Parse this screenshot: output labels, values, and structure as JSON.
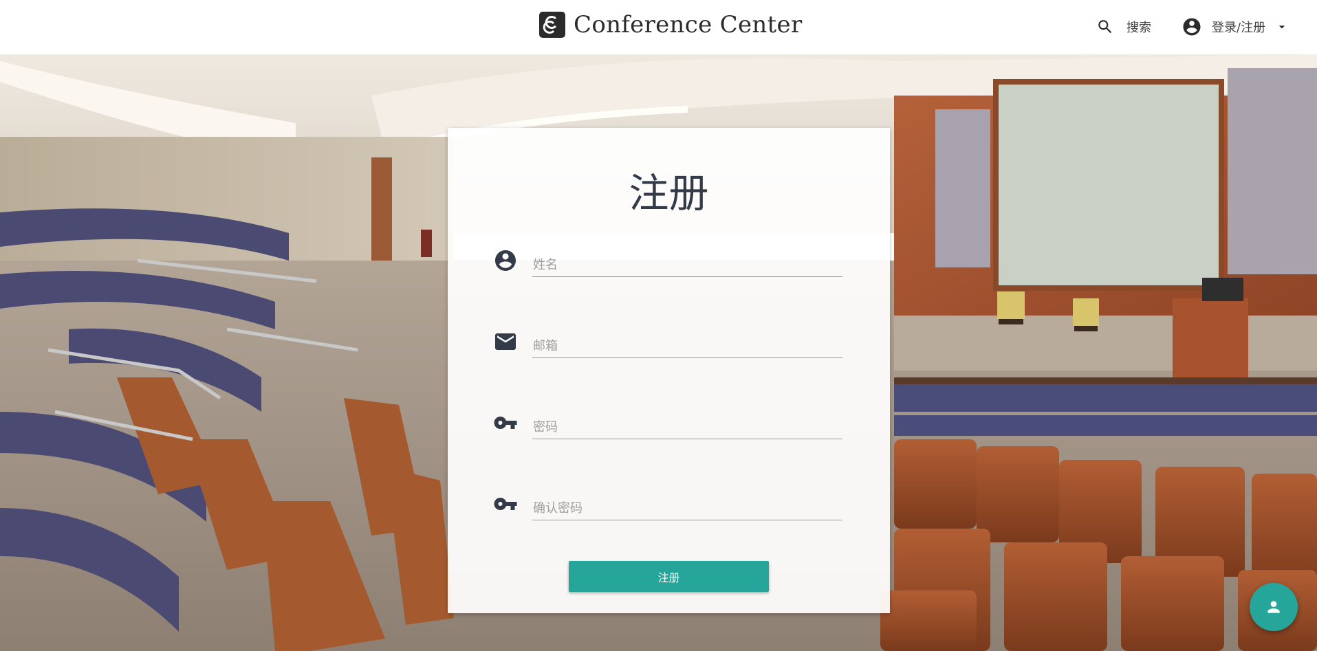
{
  "header": {
    "brand_title": "Conference Center",
    "search_label": "搜索",
    "account_label": "登录/注册"
  },
  "register_form": {
    "title": "注册",
    "fields": [
      {
        "name": "name",
        "placeholder": "姓名",
        "icon": "account-circle-icon"
      },
      {
        "name": "email",
        "placeholder": "邮箱",
        "icon": "mail-icon"
      },
      {
        "name": "password",
        "placeholder": "密码",
        "icon": "key-icon"
      },
      {
        "name": "confirm_password",
        "placeholder": "确认密码",
        "icon": "key-icon"
      }
    ],
    "submit_label": "注册"
  },
  "fab": {
    "icon": "person-icon"
  },
  "colors": {
    "accent": "#26a69a",
    "topbar_bg": "#ffffff",
    "title_text": "#333a48"
  }
}
